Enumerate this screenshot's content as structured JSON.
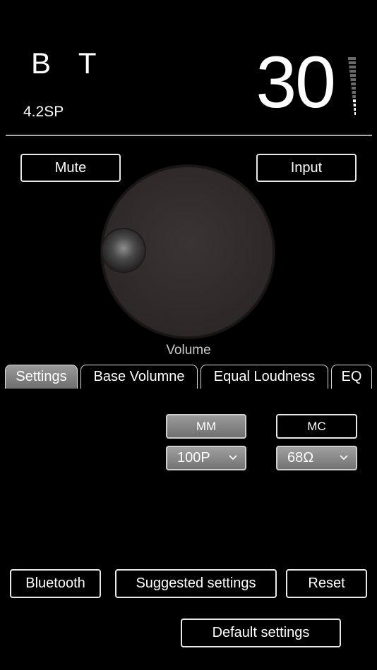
{
  "header": {
    "source_name": "B T",
    "source_sub": "4.2SP",
    "volume_value": "30",
    "level_meter_fraction": 0.3
  },
  "controls": {
    "mute_label": "Mute",
    "input_label": "Input",
    "knob_label": "Volume"
  },
  "tabs": [
    {
      "label": "Settings",
      "active": true
    },
    {
      "label": "Base Volumne",
      "active": false
    },
    {
      "label": "Equal Loudness",
      "active": false
    },
    {
      "label": "EQ",
      "active": false
    }
  ],
  "settings": {
    "mm_label": "MM",
    "mc_label": "MC",
    "capacitance_value": "100P",
    "impedance_value": "68Ω"
  },
  "footer": {
    "bluetooth_label": "Bluetooth",
    "suggested_label": "Suggested settings",
    "reset_label": "Reset",
    "default_label": "Default settings"
  },
  "colors": {
    "background": "#000000",
    "active_gray": "#8a8a8a",
    "knob": "#2d2728"
  },
  "icons": {
    "select_chevron": "chevron-down-icon",
    "level_meter": "level-meter-icon"
  }
}
